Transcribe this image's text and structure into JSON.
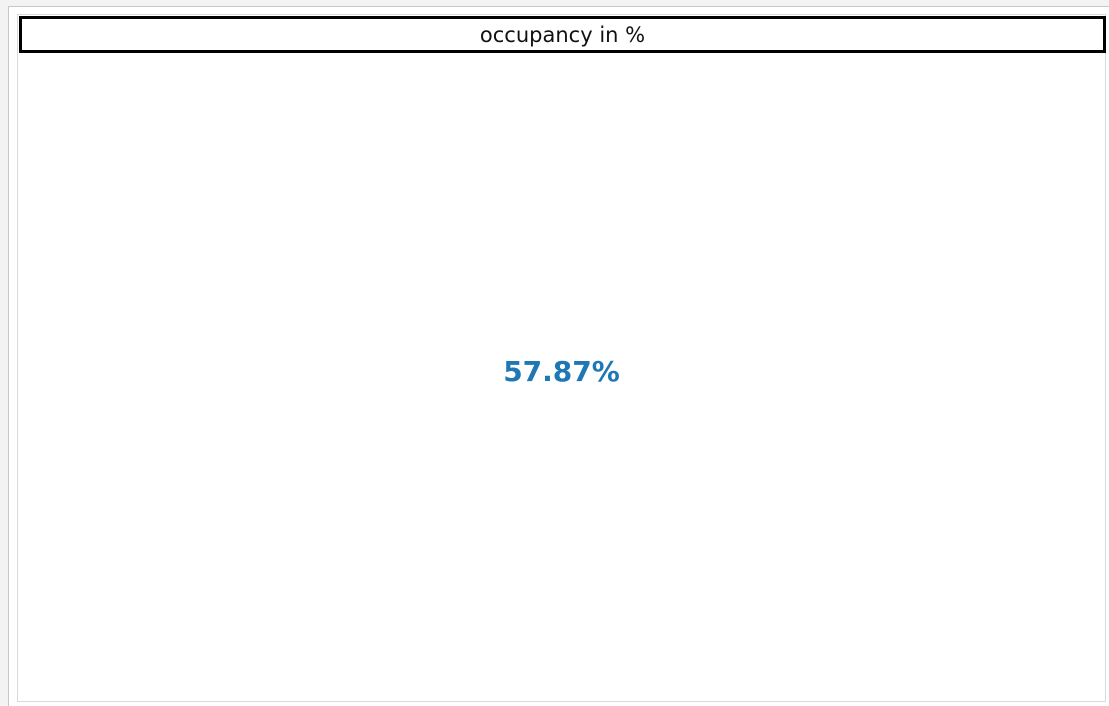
{
  "card": {
    "title": "occupancy in %",
    "value": "57.87%"
  },
  "colors": {
    "value": "#1f77b4",
    "title_border": "#000000"
  }
}
